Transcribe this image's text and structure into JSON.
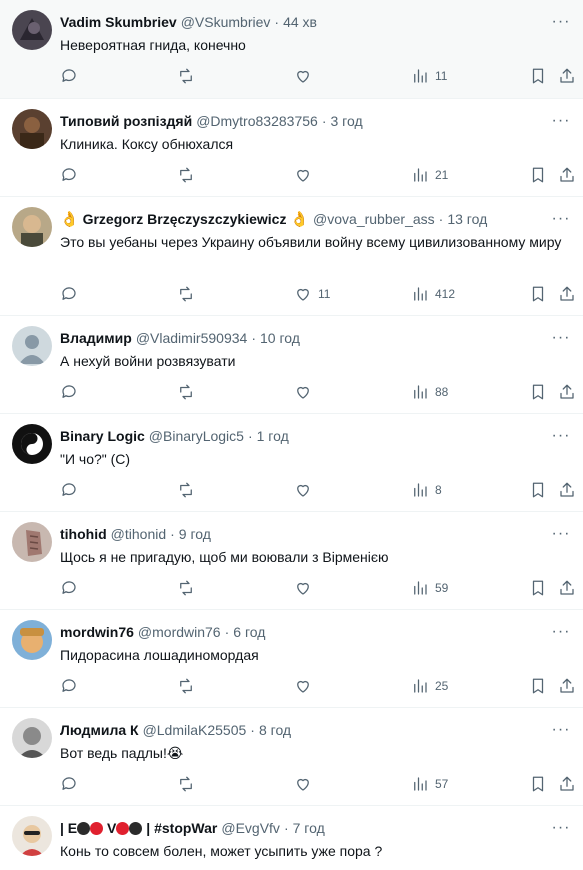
{
  "tweets": [
    {
      "name": "Vadim Skumbriev",
      "handle": "@VSkumbriev",
      "time": "44 хв",
      "text": "Невероятная гнида, конечно",
      "likes": "",
      "views": "11",
      "avatar_color": "#4a4550"
    },
    {
      "name": "Типовий розпіздяй",
      "handle": "@Dmytro83283756",
      "time": "3 год",
      "text": "Клиника. Коксу обнюхался",
      "likes": "",
      "views": "21",
      "avatar_color": "#6b4a2a"
    },
    {
      "name_prefix": "👌",
      "name": "Grzegorz Brzęczyszczykiewicz",
      "name_suffix": "👌",
      "handle": "@vova_rubber_ass",
      "time": "13 год",
      "text": "Это вы уебаны через Украину объявили войну всему цивилизованному миру",
      "likes": "11",
      "views": "412",
      "avatar_color": "#8a7a5a"
    },
    {
      "name": "Владимир",
      "handle": "@Vladimir590934",
      "time": "10 год",
      "text": "А нехуй войни розвязувати",
      "likes": "",
      "views": "88",
      "avatar_color": "#c3cdd6"
    },
    {
      "name": "Binary Logic",
      "handle": "@BinaryLogic5",
      "time": "1 год",
      "text": "\"И чо?\" (С)",
      "likes": "",
      "views": "8",
      "avatar_color": "#111111"
    },
    {
      "name": "tihohid",
      "handle": "@tihonid",
      "time": "9 год",
      "text": "Щось я не пригадую, щоб ми воювали з Вірменією",
      "likes": "",
      "views": "59",
      "avatar_color": "#a08880"
    },
    {
      "name": "mordwin76",
      "handle": "@mordwin76",
      "time": "6 год",
      "text": "Пидорасина лошадиномордая",
      "likes": "",
      "views": "25",
      "avatar_color": "#d9a45a"
    },
    {
      "name": "Людмила К",
      "handle": "@LdmilaK25505",
      "time": "8 год",
      "text": "Вот ведь падлы!",
      "text_emoji": "😭",
      "likes": "",
      "views": "57",
      "avatar_color": "#8a8a8a"
    },
    {
      "name_parts": [
        "| E",
        "",
        "",
        " V",
        "",
        "",
        " | #stopWar"
      ],
      "handle": "@EvgVfv",
      "time": "7 год",
      "text": "Конь то совсем болен, может усыпить уже пора ?",
      "avatar_color": "#e6e0d8"
    }
  ]
}
